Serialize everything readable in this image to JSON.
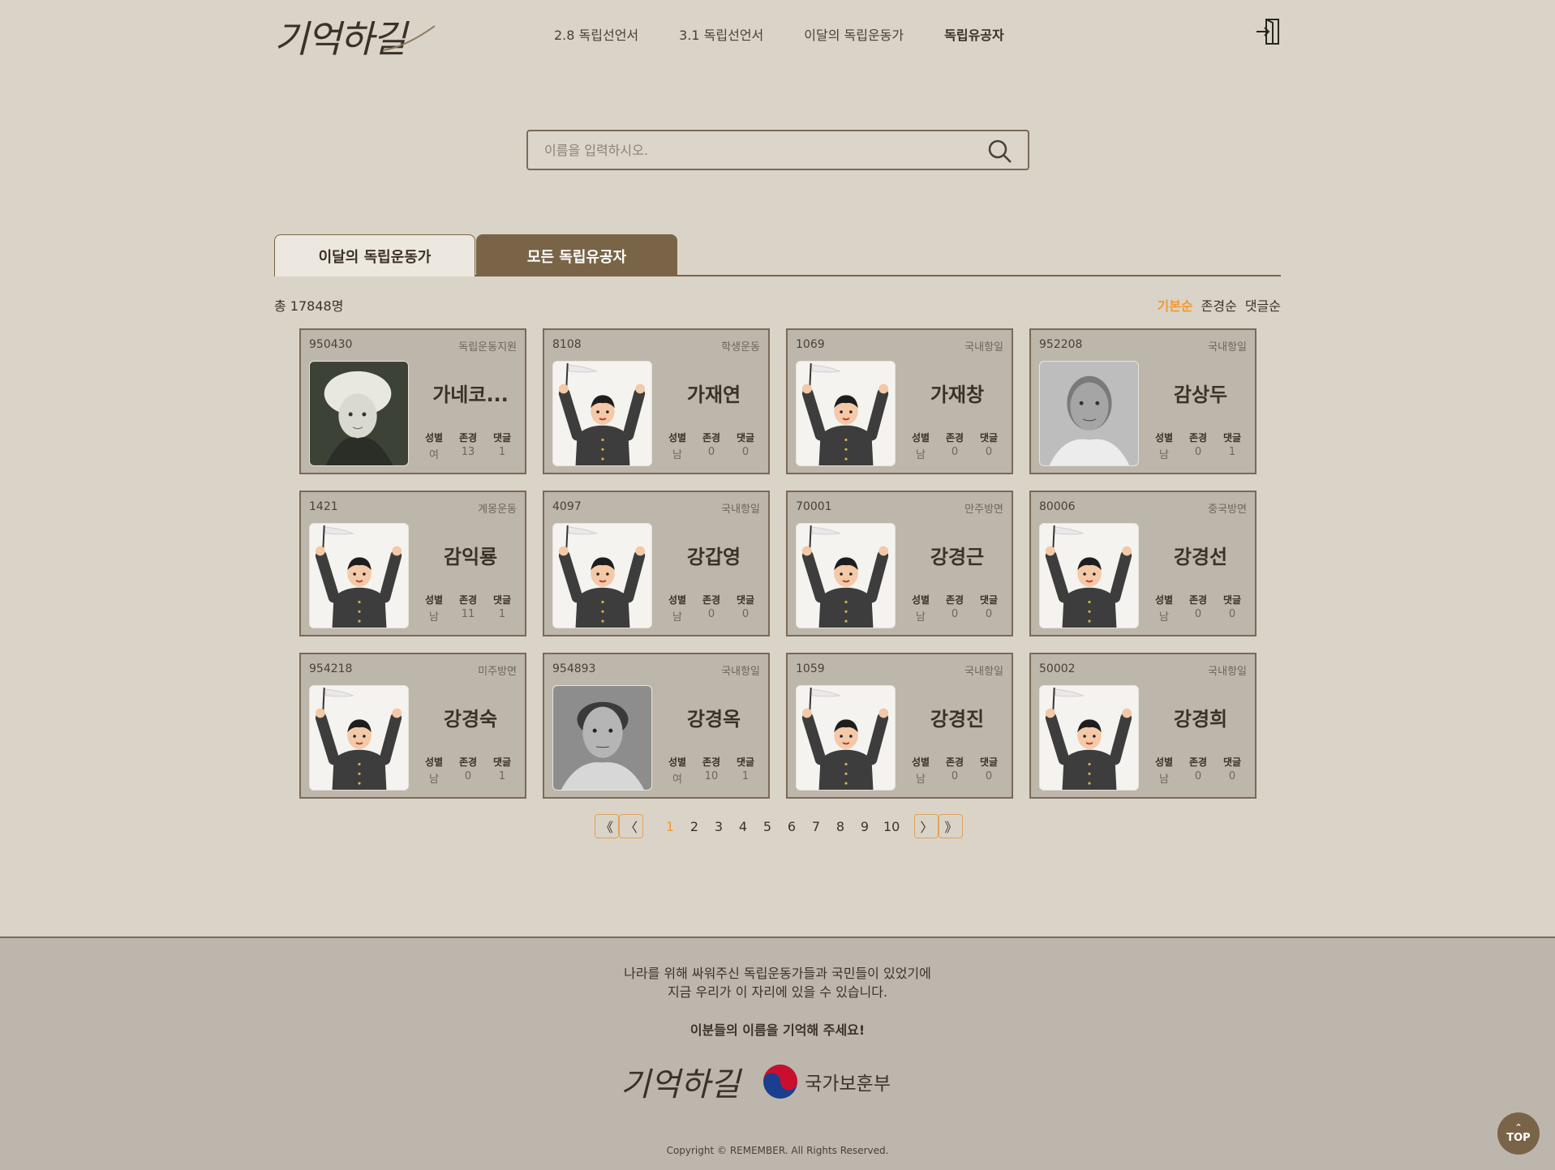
{
  "header": {
    "logo": "기억하길",
    "nav": [
      "2.8 독립선언서",
      "3.1 독립선언서",
      "이달의 독립운동가",
      "독립유공자"
    ],
    "active_nav": "독립유공자",
    "login_icon": "login-icon"
  },
  "search": {
    "placeholder": "이름을 입력하시오.",
    "value": "",
    "icon": "search-icon"
  },
  "tabs": [
    "이달의 독립운동가",
    "모든 독립유공자"
  ],
  "active_tab": "모든 독립유공자",
  "total": "총 17848명",
  "sort": [
    "기본순",
    "존경순",
    "댓글순"
  ],
  "active_sort": "기본순",
  "stat_labels": {
    "gender": "성별",
    "respect": "존경",
    "comments": "댓글"
  },
  "cards": [
    {
      "id": "950430",
      "category": "독립운동지원",
      "name": "가네코...",
      "gender": "여",
      "respect": "13",
      "comments": "1",
      "photo": "woman-portrait"
    },
    {
      "id": "8108",
      "category": "학생운동",
      "name": "가재연",
      "gender": "남",
      "respect": "0",
      "comments": "0",
      "photo": "default-illustration"
    },
    {
      "id": "1069",
      "category": "국내항일",
      "name": "가재창",
      "gender": "남",
      "respect": "0",
      "comments": "0",
      "photo": "default-illustration"
    },
    {
      "id": "952208",
      "category": "국내항일",
      "name": "감상두",
      "gender": "남",
      "respect": "0",
      "comments": "1",
      "photo": "man-portrait"
    },
    {
      "id": "1421",
      "category": "계몽운동",
      "name": "감익룡",
      "gender": "남",
      "respect": "11",
      "comments": "1",
      "photo": "default-illustration"
    },
    {
      "id": "4097",
      "category": "국내항일",
      "name": "강갑영",
      "gender": "남",
      "respect": "0",
      "comments": "0",
      "photo": "default-illustration"
    },
    {
      "id": "70001",
      "category": "만주방면",
      "name": "강경근",
      "gender": "남",
      "respect": "0",
      "comments": "0",
      "photo": "default-illustration"
    },
    {
      "id": "80006",
      "category": "중국방면",
      "name": "강경선",
      "gender": "남",
      "respect": "0",
      "comments": "0",
      "photo": "default-illustration"
    },
    {
      "id": "954218",
      "category": "미주방면",
      "name": "강경숙",
      "gender": "남",
      "respect": "0",
      "comments": "1",
      "photo": "default-illustration"
    },
    {
      "id": "954893",
      "category": "국내항일",
      "name": "강경옥",
      "gender": "여",
      "respect": "10",
      "comments": "1",
      "photo": "elder-portrait"
    },
    {
      "id": "1059",
      "category": "국내항일",
      "name": "강경진",
      "gender": "남",
      "respect": "0",
      "comments": "0",
      "photo": "default-illustration"
    },
    {
      "id": "50002",
      "category": "국내항일",
      "name": "강경희",
      "gender": "남",
      "respect": "0",
      "comments": "0",
      "photo": "default-illustration"
    }
  ],
  "pagination": {
    "first": "《",
    "prev": "〈",
    "pages": [
      "1",
      "2",
      "3",
      "4",
      "5",
      "6",
      "7",
      "8",
      "9",
      "10"
    ],
    "current": "1",
    "next": "〉",
    "last": "》"
  },
  "footer": {
    "line1": "나라를 위해 싸워주신 독립운동가들과 국민들이 있었기에",
    "line2": "지금 우리가 이 자리에 있을 수 있습니다.",
    "strong": "이분들의 이름을 기억해 주세요!",
    "logo": "기억하길",
    "gov": "국가보훈부",
    "copyright": "Copyright © REMEMBER. All Rights Reserved.",
    "top_arrow": "⌃",
    "top": "TOP"
  },
  "colors": {
    "background": "#dad3c8",
    "accent": "#7a6447",
    "highlight": "#f29a2e",
    "card": "#bdb6ab"
  }
}
